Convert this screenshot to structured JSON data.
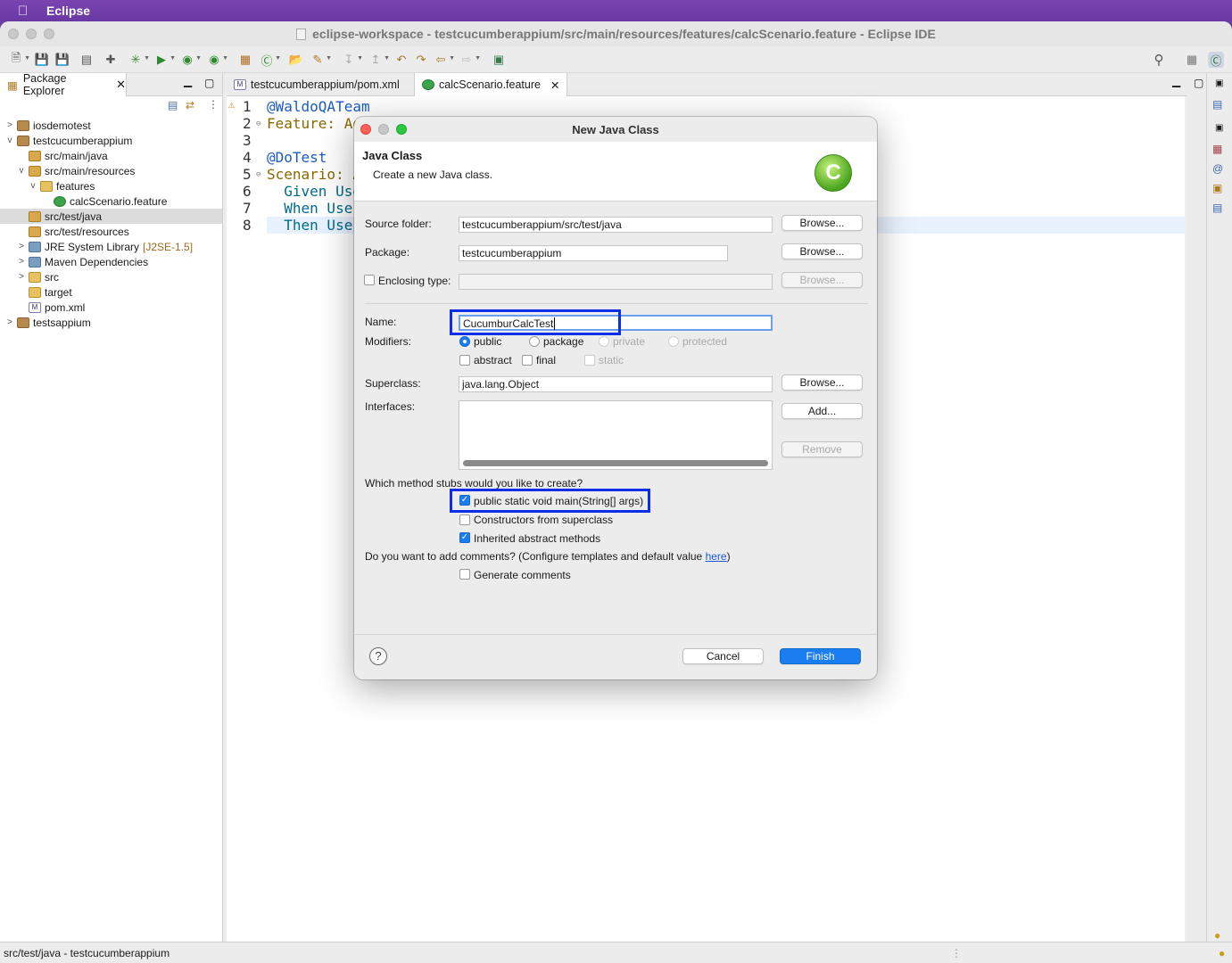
{
  "menubar": {
    "apple": "",
    "app_name": "Eclipse"
  },
  "window": {
    "title": "eclipse-workspace - testcucumberappium/src/main/resources/features/calcScenario.feature - Eclipse IDE"
  },
  "package_explorer": {
    "tab_label": "Package Explorer",
    "tree": [
      {
        "label": "iosdemotest",
        "twisty": ">"
      },
      {
        "label": "testcucumberappium",
        "twisty": "v"
      },
      {
        "label": "src/main/java",
        "twisty": ""
      },
      {
        "label": "src/main/resources",
        "twisty": "v"
      },
      {
        "label": "features",
        "twisty": "v"
      },
      {
        "label": "calcScenario.feature",
        "twisty": ""
      },
      {
        "label": "src/test/java",
        "twisty": "",
        "selected": true
      },
      {
        "label": "src/test/resources",
        "twisty": ""
      },
      {
        "label": "JRE System Library",
        "decoration": "[J2SE-1.5]",
        "twisty": ">"
      },
      {
        "label": "Maven Dependencies",
        "twisty": ">"
      },
      {
        "label": "src",
        "twisty": ">"
      },
      {
        "label": "target",
        "twisty": ""
      },
      {
        "label": "pom.xml",
        "twisty": ""
      },
      {
        "label": "testsappium",
        "twisty": ">"
      }
    ]
  },
  "editor": {
    "tabs": [
      {
        "label": "testcucumberappium/pom.xml"
      },
      {
        "label": "calcScenario.feature",
        "close": "✕"
      }
    ],
    "lines": [
      {
        "num": "1",
        "text": "@WaldoQATeam"
      },
      {
        "num": "2",
        "text": "Feature: Ad"
      },
      {
        "num": "3",
        "text": ""
      },
      {
        "num": "4",
        "text": "@DoTest"
      },
      {
        "num": "5",
        "text": "Scenario: A"
      },
      {
        "num": "6",
        "text": "  Given Use"
      },
      {
        "num": "7",
        "text": "  When Use"
      },
      {
        "num": "8",
        "text": "  Then Use"
      }
    ]
  },
  "dialog": {
    "title": "New Java Class",
    "header_title": "Java Class",
    "header_desc": "Create a new Java class.",
    "logo_letter": "C",
    "source_folder_label": "Source folder:",
    "source_folder_value": "testcucumberappium/src/test/java",
    "package_label": "Package:",
    "package_value": "testcucumberappium",
    "enclosing_label": "Enclosing type:",
    "enclosing_value": "",
    "browse_label": "Browse...",
    "name_label": "Name:",
    "name_value": "CucumburCalcTest",
    "modifiers_label": "Modifiers:",
    "modifier_public": "public",
    "modifier_package": "package",
    "modifier_private": "private",
    "modifier_protected": "protected",
    "mod_abstract": "abstract",
    "mod_final": "final",
    "mod_static": "static",
    "superclass_label": "Superclass:",
    "superclass_value": "java.lang.Object",
    "interfaces_label": "Interfaces:",
    "add_label": "Add...",
    "remove_label": "Remove",
    "stubs_question": "Which method stubs would you like to create?",
    "stub_main": "public static void main(String[] args)",
    "stub_constructors": "Constructors from superclass",
    "stub_inherited": "Inherited abstract methods",
    "comments_question": "Do you want to add comments? (Configure templates and default value ",
    "comments_link": "here",
    "comments_close": ")",
    "generate_comments": "Generate comments",
    "help_label": "?",
    "cancel_label": "Cancel",
    "finish_label": "Finish"
  },
  "statusbar": {
    "text": "src/test/java - testcucumberappium"
  },
  "colors": {
    "accent": "#1a7df0",
    "highlight_box": "#0a2fe6",
    "menubar": "#6a38a4"
  }
}
